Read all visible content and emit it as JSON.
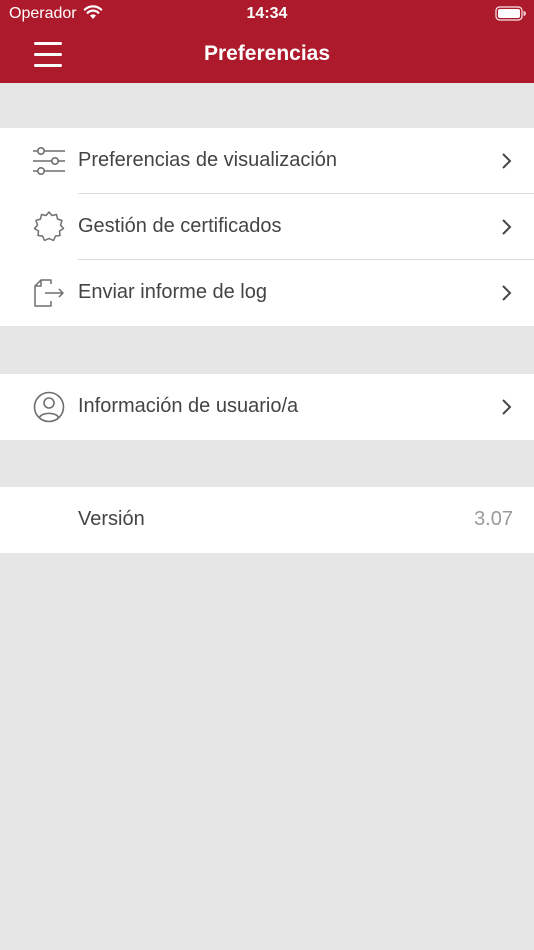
{
  "status_bar": {
    "carrier": "Operador",
    "time": "14:34"
  },
  "nav": {
    "title": "Preferencias"
  },
  "groups": [
    {
      "items": [
        {
          "label": "Preferencias de visualización",
          "icon": "sliders-icon"
        },
        {
          "label": "Gestión de certificados",
          "icon": "certificate-badge-icon"
        },
        {
          "label": "Enviar informe de log",
          "icon": "export-file-icon"
        }
      ]
    },
    {
      "items": [
        {
          "label": "Información de usuario/a",
          "icon": "user-circle-icon"
        }
      ]
    }
  ],
  "version": {
    "label": "Versión",
    "value": "3.07"
  },
  "colors": {
    "brand": "#ad1a2b",
    "background": "#e6e6e6",
    "text": "#444444",
    "muted": "#9a9a9a"
  }
}
